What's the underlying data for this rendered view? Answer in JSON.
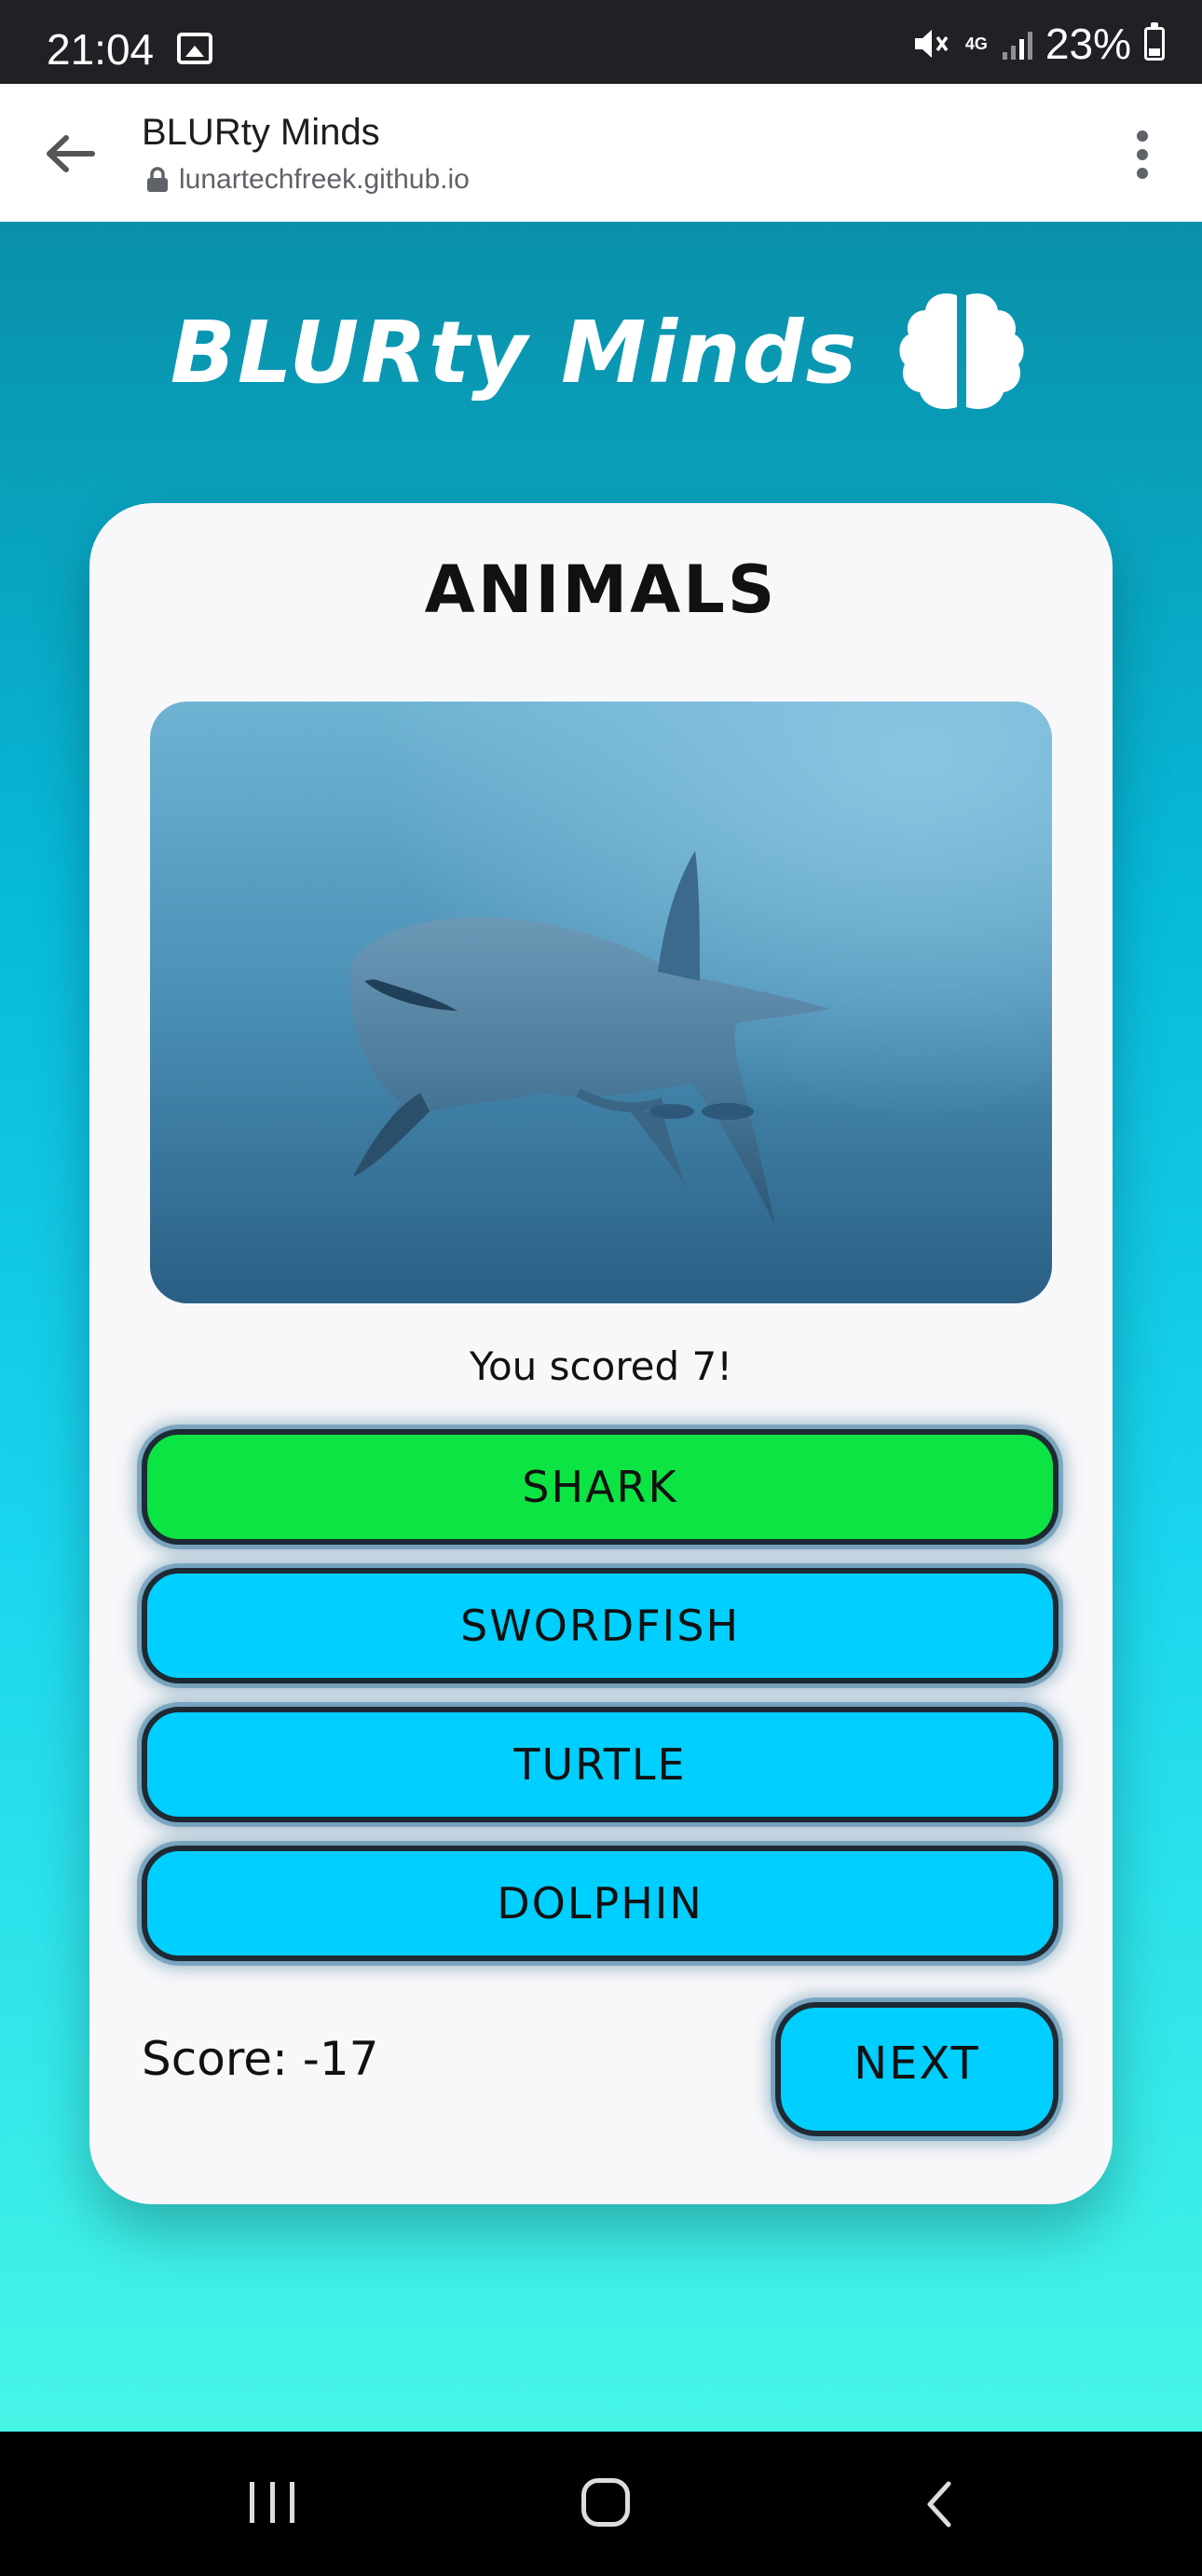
{
  "status_bar": {
    "time": "21:04",
    "network": "4G",
    "battery": "23%",
    "icons": [
      "gallery-icon",
      "mute-icon",
      "signal-icon",
      "battery-icon"
    ]
  },
  "browser": {
    "title": "BLURty Minds",
    "url": "lunartechfreek.github.io"
  },
  "app": {
    "logo_text": "BLURty Minds",
    "category": "ANIMALS",
    "result_text": "You scored 7!",
    "answers": [
      {
        "label": "SHARK",
        "state": "correct"
      },
      {
        "label": "SWORDFISH",
        "state": "default"
      },
      {
        "label": "TURTLE",
        "state": "default"
      },
      {
        "label": "DOLPHIN",
        "state": "default"
      }
    ],
    "score_text": "Score: -17",
    "next_label": "NEXT"
  },
  "colors": {
    "answer_default": "#00cfff",
    "answer_correct": "#0be442",
    "card": "#f8f8fb"
  }
}
